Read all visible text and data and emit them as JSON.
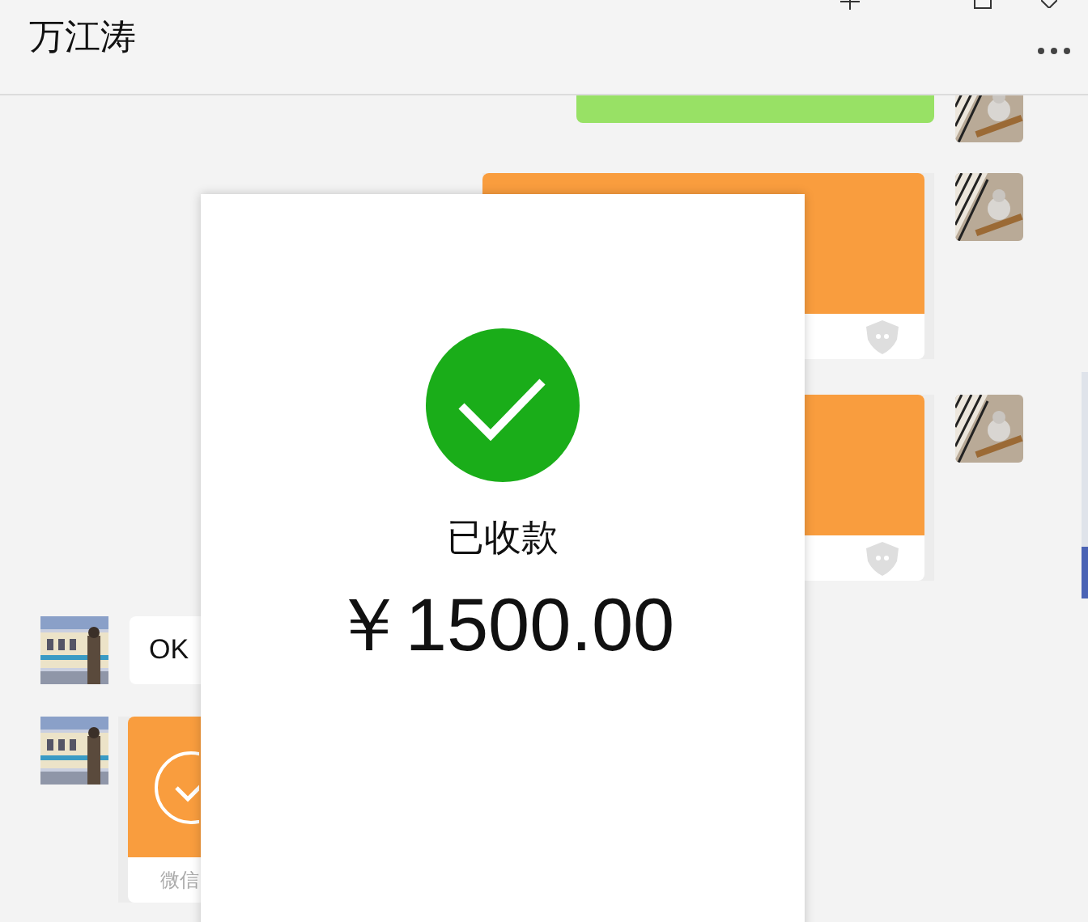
{
  "header": {
    "title": "万江涛"
  },
  "messages": [
    {
      "kind": "text",
      "outgoing": true
    },
    {
      "kind": "transfer",
      "outgoing": true
    },
    {
      "kind": "transfer",
      "outgoing": true
    },
    {
      "kind": "text",
      "outgoing": false,
      "text": "OK"
    },
    {
      "kind": "transfer",
      "outgoing": false,
      "received": true,
      "footer_label": "微信"
    }
  ],
  "modal": {
    "status": "已收款",
    "amount": "￥1500.00"
  }
}
